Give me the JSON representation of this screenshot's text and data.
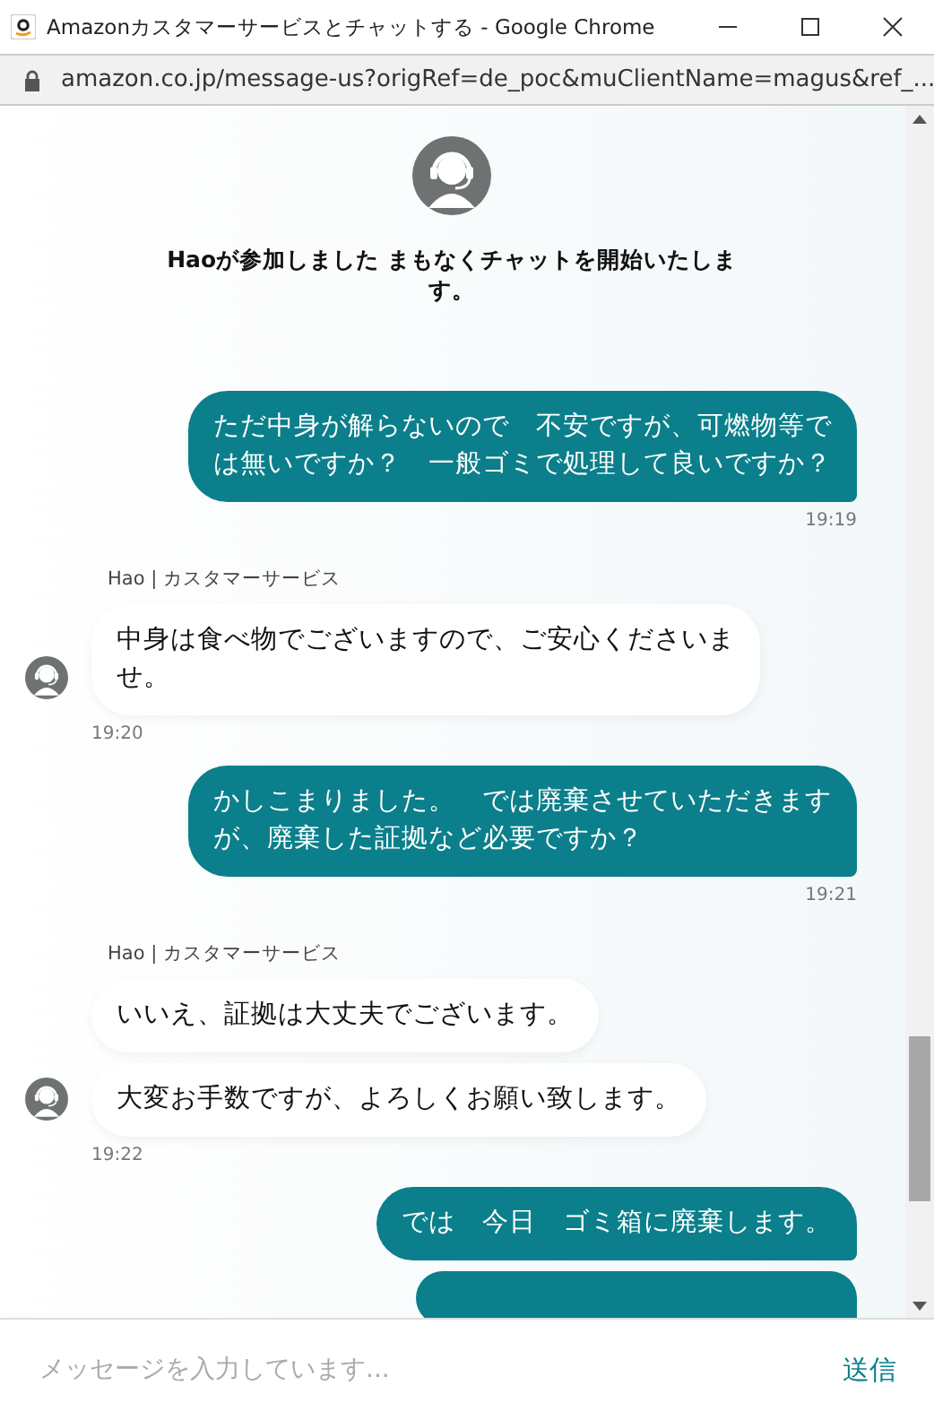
{
  "window": {
    "title": "Amazonカスタマーサービスとチャットする - Google Chrome"
  },
  "address_bar": {
    "url": "amazon.co.jp/message-us?origRef=de_poc&muClientName=magus&ref_..."
  },
  "chat": {
    "system_message": "Haoが参加しました まもなくチャットを開始いたします。",
    "messages": [
      {
        "kind": "user",
        "bubbles": [
          "ただ中身が解らないので　不安ですが、可燃物等では無いですか？　一般ゴミで処理して良いですか？"
        ],
        "time": "19:19"
      },
      {
        "kind": "agent",
        "name": "Hao | カスタマーサービス",
        "bubbles": [
          "中身は食べ物でございますので、ご安心くださいませ。"
        ],
        "time": "19:20"
      },
      {
        "kind": "user",
        "bubbles": [
          "かしこまりました。　では廃棄させていただきますが、廃棄した証拠など必要ですか？"
        ],
        "time": "19:21"
      },
      {
        "kind": "agent",
        "name": "Hao | カスタマーサービス",
        "bubbles": [
          "いいえ、証拠は大丈夫でございます。",
          "大変お手数ですが、よろしくお願い致します。"
        ],
        "time": "19:22"
      },
      {
        "kind": "user",
        "bubbles": [
          "では　今日　ゴミ箱に廃棄します。"
        ],
        "more_below": true
      }
    ]
  },
  "composer": {
    "placeholder": "メッセージを入力しています...",
    "send_label": "送信"
  }
}
